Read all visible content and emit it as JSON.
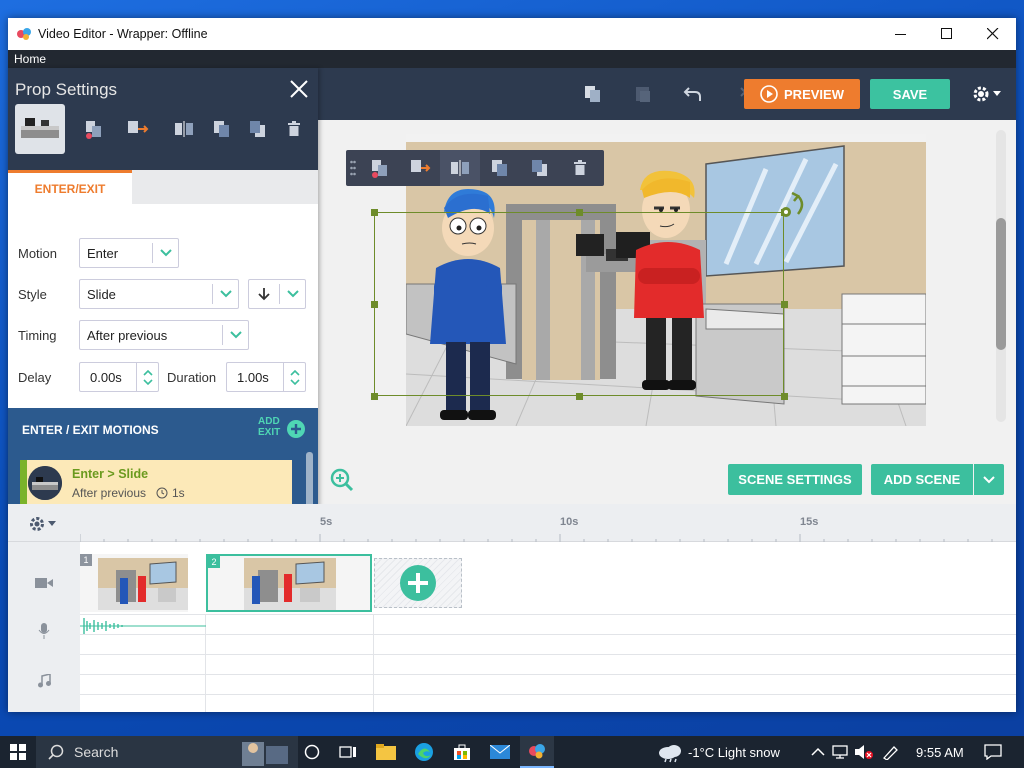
{
  "window": {
    "title": "Video Editor - Wrapper: Offline",
    "menu_home": "Home"
  },
  "toolbar": {
    "preview_label": "PREVIEW",
    "save_label": "SAVE"
  },
  "panel": {
    "title": "Prop Settings",
    "tab_enter_exit": "ENTER/EXIT",
    "motion_label": "Motion",
    "motion_value": "Enter",
    "style_label": "Style",
    "style_value": "Slide",
    "timing_label": "Timing",
    "timing_value": "After previous",
    "delay_label": "Delay",
    "delay_value": "0.00s",
    "duration_label": "Duration",
    "duration_value": "1.00s",
    "motions_title": "ENTER / EXIT MOTIONS",
    "add_exit_line1": "ADD",
    "add_exit_line2": "EXIT",
    "motion_item_title": "Enter > Slide",
    "motion_item_timing": "After previous",
    "motion_item_duration": "1s"
  },
  "stage": {
    "scene_settings_label": "SCENE SETTINGS",
    "add_scene_label": "ADD SCENE"
  },
  "timeline": {
    "ticks": [
      "5s",
      "10s",
      "15s"
    ],
    "scene_numbers": [
      "1",
      "2"
    ]
  },
  "taskbar": {
    "search_placeholder": "Search",
    "weather": "-1°C  Light snow",
    "time": "9:55 AM"
  },
  "colors": {
    "toolbar_bg": "#2d3a4f",
    "preview_orange": "#ee7c2e",
    "save_teal": "#3cc2a0",
    "motions_blue": "#2c5a8e",
    "selection_green": "#6e8c2a"
  }
}
